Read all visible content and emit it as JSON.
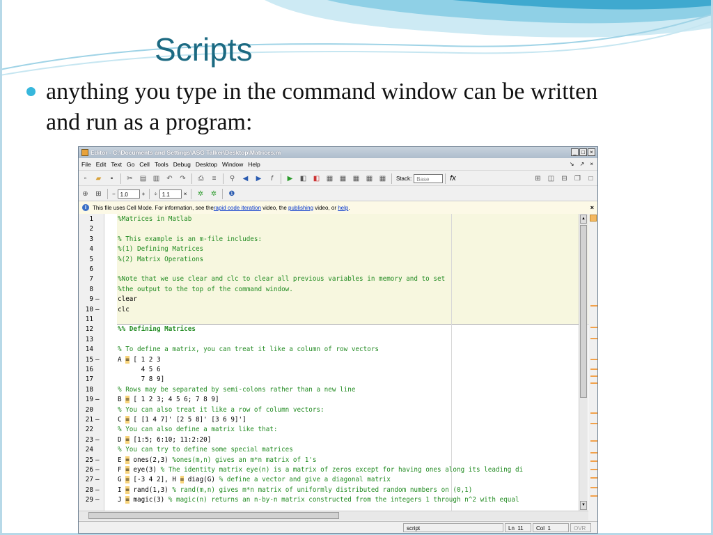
{
  "slide": {
    "title": "Scripts",
    "bullet": "anything you type in the command window can be written and run as a program:"
  },
  "colors": {
    "title": "#1c6a82",
    "bullet_dot": "#37b7dc",
    "comment": "#228b22",
    "cell_background": "#f7f7df"
  },
  "editor_window": {
    "title": "Editor - C:\\Documents and Settings\\ASG Talker\\Desktop\\Matrices.m",
    "window_buttons": [
      "_",
      "□",
      "×"
    ],
    "menu": [
      "File",
      "Edit",
      "Text",
      "Go",
      "Cell",
      "Tools",
      "Debug",
      "Desktop",
      "Window",
      "Help"
    ],
    "menu_right": [
      "↘",
      "↗",
      "×"
    ],
    "toolbar1": {
      "icons": [
        "new-file-icon",
        "open-folder-icon",
        "save-icon",
        "cut-icon",
        "copy-icon",
        "paste-icon",
        "undo-icon",
        "redo-icon",
        "print-icon",
        "comment-icon",
        "find-icon",
        "back-icon",
        "forward-icon",
        "function-browser-icon",
        "run-icon",
        "breakpoint-icon",
        "clear-breakpoint-icon",
        "step-icon",
        "step-in-icon",
        "step-out-icon",
        "continue-icon",
        "exit-debug-icon"
      ],
      "stack_label": "Stack:",
      "stack_value": "Base",
      "fx_label": "fx"
    },
    "toolbar2": {
      "minus_label": "−",
      "value1": "1.0",
      "plus_label": "+",
      "divide_label": "÷",
      "value2": "1.1",
      "times_label": "×"
    },
    "info": {
      "prefix": "This file uses Cell Mode. For information, see the ",
      "link1": "rapid code iteration",
      "middle1": " video, the ",
      "link2": "publishing",
      "middle2": " video, or ",
      "link3": "help",
      "suffix": ".",
      "close_label": "×"
    },
    "lines": [
      {
        "n": "1",
        "m": "",
        "t": "%Matrices in Matlab",
        "k": "com"
      },
      {
        "n": "2",
        "m": "",
        "t": "",
        "k": "code"
      },
      {
        "n": "3",
        "m": "",
        "t": "% This example is an m-file includes:",
        "k": "com"
      },
      {
        "n": "4",
        "m": "",
        "t": "%(1) Defining Matrices",
        "k": "com"
      },
      {
        "n": "5",
        "m": "",
        "t": "%(2) Matrix Operations",
        "k": "com"
      },
      {
        "n": "6",
        "m": "",
        "t": "",
        "k": "code"
      },
      {
        "n": "7",
        "m": "",
        "t": "%Note that we use clear and clc to clear all previous variables in memory and to set",
        "k": "com"
      },
      {
        "n": "8",
        "m": "",
        "t": "%the output to the top of the command window.",
        "k": "com"
      },
      {
        "n": "9",
        "m": "–",
        "t": "clear",
        "k": "code"
      },
      {
        "n": "10",
        "m": "–",
        "t": "clc",
        "k": "code"
      },
      {
        "n": "11",
        "m": "",
        "t": "",
        "k": "code"
      },
      {
        "n": "12",
        "m": "",
        "t": "%% Defining Matrices",
        "k": "cell"
      },
      {
        "n": "13",
        "m": "",
        "t": "",
        "k": "code"
      },
      {
        "n": "14",
        "m": "",
        "t": "% To define a matrix, you can treat it like a column of row vectors",
        "k": "com"
      },
      {
        "n": "15",
        "m": "–",
        "t": "A = [ 1 2 3",
        "k": "code"
      },
      {
        "n": "16",
        "m": "",
        "t": "      4 5 6",
        "k": "code"
      },
      {
        "n": "17",
        "m": "",
        "t": "      7 8 9]",
        "k": "code"
      },
      {
        "n": "18",
        "m": "",
        "t": "% Rows may be separated by semi-colons rather than a new line",
        "k": "com"
      },
      {
        "n": "19",
        "m": "–",
        "t": "B = [ 1 2 3; 4 5 6; 7 8 9]",
        "k": "code"
      },
      {
        "n": "20",
        "m": "",
        "t": "% You can also treat it like a row of column vectors:",
        "k": "com"
      },
      {
        "n": "21",
        "m": "–",
        "t": "C = [ [1 4 7]' [2 5 8]' [3 6 9]']",
        "k": "code"
      },
      {
        "n": "22",
        "m": "",
        "t": "% You can also define a matrix like that:",
        "k": "com"
      },
      {
        "n": "23",
        "m": "–",
        "t": "D = [1:5; 6:10; 11:2:20]",
        "k": "code"
      },
      {
        "n": "24",
        "m": "",
        "t": "% You can try to define some special matrices",
        "k": "com"
      },
      {
        "n": "25",
        "m": "–",
        "t": "E = ones(2,3) %ones(m,n) gives an m*n matrix of 1's",
        "k": "mix"
      },
      {
        "n": "26",
        "m": "–",
        "t": "F = eye(3) % The identity matrix eye(n) is a matrix of zeros except for having ones along its leading di",
        "k": "mix"
      },
      {
        "n": "27",
        "m": "–",
        "t": "G = [-3 4 2], H = diag(G) % define a vector and give a diagonal matrix",
        "k": "mix"
      },
      {
        "n": "28",
        "m": "–",
        "t": "I = rand(1,3) % rand(m,n) gives m*n matrix of uniformly distributed random numbers on (0,1)",
        "k": "mix"
      },
      {
        "n": "29",
        "m": "–",
        "t": "J = magic(3) % magic(n) returns an n-by-n matrix constructed from the integers 1 through n^2 with equal",
        "k": "mix"
      }
    ],
    "status": {
      "mode": "script",
      "ln_label": "Ln",
      "ln_value": "11",
      "col_label": "Col",
      "col_value": "1",
      "ovr": "OVR"
    }
  }
}
